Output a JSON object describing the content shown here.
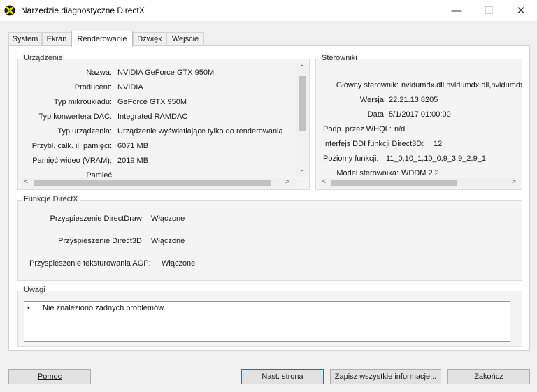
{
  "window": {
    "title": "Narzędzie diagnostyczne DirectX",
    "minimize": "—",
    "maximize": "☐",
    "close": "✕"
  },
  "tabs": [
    "System",
    "Ekran",
    "Renderowanie",
    "Dźwięk",
    "Wejście"
  ],
  "device": {
    "group_label": "Urządzenie",
    "rows": [
      {
        "label": "Nazwa:",
        "value": "NVIDIA GeForce GTX 950M"
      },
      {
        "label": "Producent:",
        "value": "NVIDIA"
      },
      {
        "label": "Typ mikroukładu:",
        "value": "GeForce GTX 950M"
      },
      {
        "label": "Typ konwertera DAC:",
        "value": "Integrated RAMDAC"
      },
      {
        "label": "Typ urządzenia:",
        "value": "Urządzenie wyświetlające tylko do renderowania"
      },
      {
        "label": "Przybl. całk. il. pamięci:",
        "value": "6071 MB"
      },
      {
        "label": "Pamięć wideo (VRAM):",
        "value": "2019 MB"
      },
      {
        "label": "Pamięć",
        "value": ""
      }
    ]
  },
  "drivers": {
    "group_label": "Sterowniki",
    "rows": [
      {
        "label": "Główny sterownik:",
        "value": "nvldumdx.dll,nvldumdx.dll,nvldumdx.dll"
      },
      {
        "label": "Wersja:",
        "value": "22.21.13.8205"
      },
      {
        "label": "Data:",
        "value": "5/1/2017 01:00:00"
      },
      {
        "label": "Podp. przez WHQL:",
        "value": "n/d"
      },
      {
        "label": "Interfejs DDI funkcji Direct3D:",
        "value": "12"
      },
      {
        "label": "Poziomy funkcji:",
        "value": "11_0,10_1,10_0,9_3,9_2,9_1"
      },
      {
        "label": "Model sterownika:",
        "value": "WDDM 2.2"
      }
    ]
  },
  "directx": {
    "group_label": "Funkcje DirectX",
    "rows": [
      {
        "label": "Przyspieszenie DirectDraw:",
        "value": "Włączone"
      },
      {
        "label": "Przyspieszenie Direct3D:",
        "value": "Włączone"
      },
      {
        "label": "Przyspieszenie teksturowania AGP:",
        "value": "Włączone"
      }
    ]
  },
  "notes": {
    "group_label": "Uwagi",
    "items": [
      "Nie znaleziono żadnych problemów."
    ]
  },
  "buttons": {
    "help": "Pomoc",
    "next": "Nast. strona",
    "save": "Zapisz wszystkie informacje...",
    "exit": "Zakończ"
  }
}
